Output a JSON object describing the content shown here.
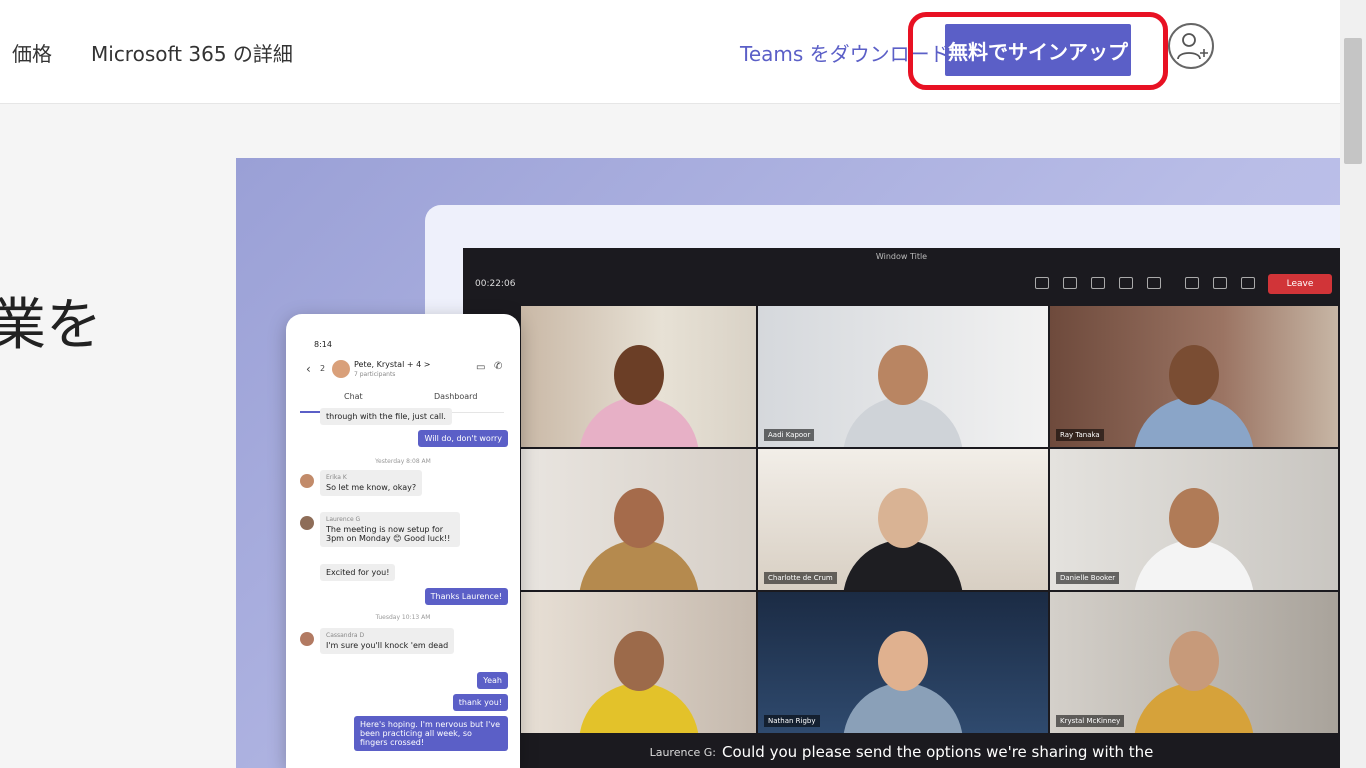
{
  "nav": {
    "pricing": "価格",
    "m365_details": "Microsoft 365 の詳細",
    "download_link": "Teams をダウンロード",
    "signup_button": "無料でサインアップ",
    "account_icon": "person-add-icon"
  },
  "hero": {
    "partial_heading": "業を"
  },
  "teams_window": {
    "title": "Window Title",
    "timer": "00:22:06",
    "leave_label": "Leave",
    "participants": [
      {
        "name": ""
      },
      {
        "name": "Aadi Kapoor"
      },
      {
        "name": "Ray Tanaka"
      },
      {
        "name": ""
      },
      {
        "name": "Charlotte de Crum"
      },
      {
        "name": "Danielle Booker"
      },
      {
        "name": ""
      },
      {
        "name": "Nathan Rigby"
      },
      {
        "name": "Krystal McKinney"
      }
    ],
    "caption_speaker": "Laurence G:",
    "caption_text": "Could you please send the options we're sharing with the"
  },
  "phone": {
    "time": "8:14",
    "back_count": "2",
    "chat_title": "Pete, Krystal + 4 >",
    "chat_subtitle": "7 participants",
    "tab_chat": "Chat",
    "tab_dashboard": "Dashboard",
    "messages": [
      {
        "text": "through with the file, just call."
      },
      {
        "text": "Will do, don't worry"
      },
      {
        "text": "Yesterday 8:08 AM"
      },
      {
        "name": "Erika K",
        "text": "So let me know, okay?"
      },
      {
        "name": "Laurence G",
        "text": "The meeting is now setup for 3pm on Monday 😊 Good luck!!"
      },
      {
        "text": "Excited for you!"
      },
      {
        "text": "Thanks Laurence!"
      },
      {
        "text": "Tuesday 10:13 AM"
      },
      {
        "name": "Cassandra D",
        "text": "I'm sure you'll knock 'em dead"
      },
      {
        "text": "Yeah"
      },
      {
        "text": "thank you!"
      },
      {
        "text": "Here's hoping. I'm nervous but I've been practicing all week, so fingers crossed!"
      }
    ]
  }
}
